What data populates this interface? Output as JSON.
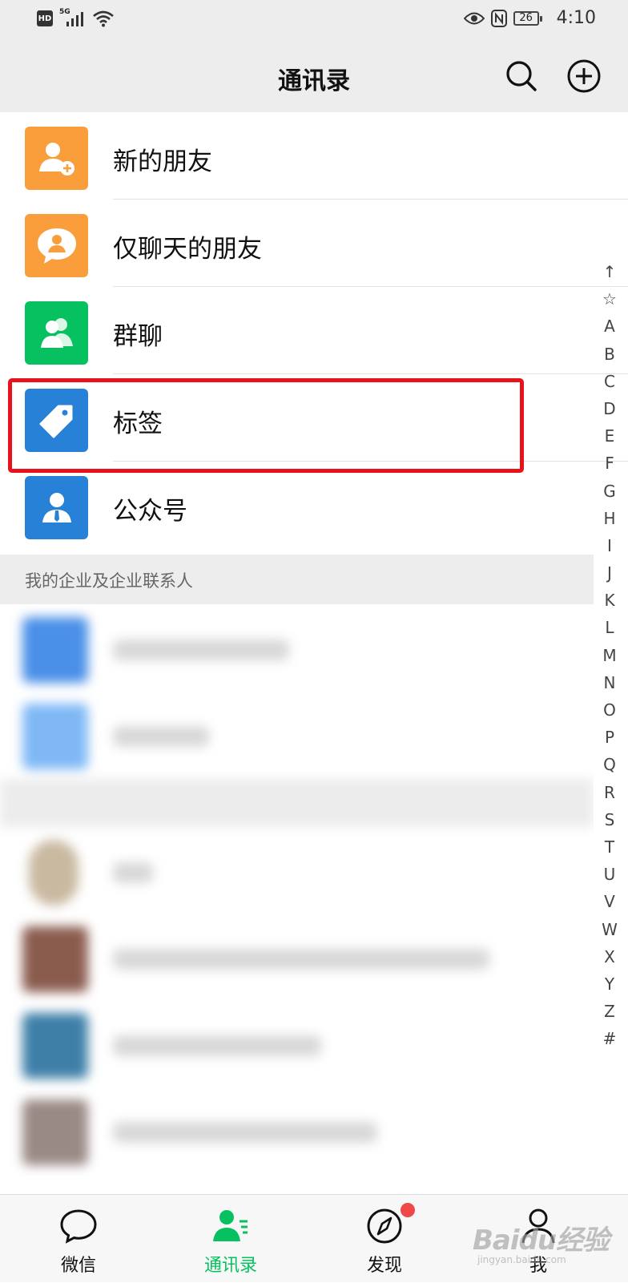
{
  "status_bar": {
    "hd": "HD",
    "network": "5G",
    "battery": "26",
    "time": "4:10"
  },
  "header": {
    "title": "通讯录"
  },
  "functions": [
    {
      "label": "新的朋友",
      "icon": "add-friend-icon",
      "color": "#fa9d3b"
    },
    {
      "label": "仅聊天的朋友",
      "icon": "chat-only-friend-icon",
      "color": "#fa9d3b"
    },
    {
      "label": "群聊",
      "icon": "group-chat-icon",
      "color": "#07c160"
    },
    {
      "label": "标签",
      "icon": "tag-icon",
      "color": "#2782d7"
    },
    {
      "label": "公众号",
      "icon": "official-account-icon",
      "color": "#2782d7"
    }
  ],
  "section": {
    "enterprise_title": "我的企业及企业联系人"
  },
  "alpha_index": [
    "↑",
    "☆",
    "A",
    "B",
    "C",
    "D",
    "E",
    "F",
    "G",
    "H",
    "I",
    "J",
    "K",
    "L",
    "M",
    "N",
    "O",
    "P",
    "Q",
    "R",
    "S",
    "T",
    "U",
    "V",
    "W",
    "X",
    "Y",
    "Z",
    "#"
  ],
  "tabs": [
    {
      "label": "微信",
      "icon": "chat-bubble-icon",
      "active": false
    },
    {
      "label": "通讯录",
      "icon": "contacts-icon",
      "active": true
    },
    {
      "label": "发现",
      "icon": "compass-icon",
      "active": false
    },
    {
      "label": "我",
      "icon": "person-icon",
      "active": false
    }
  ],
  "watermark": {
    "brand": "Baidu经验",
    "sub": "jingyan.baidu.com"
  },
  "colors": {
    "accent": "#07c160",
    "highlight": "#e8121c",
    "badge": "#f04848"
  }
}
